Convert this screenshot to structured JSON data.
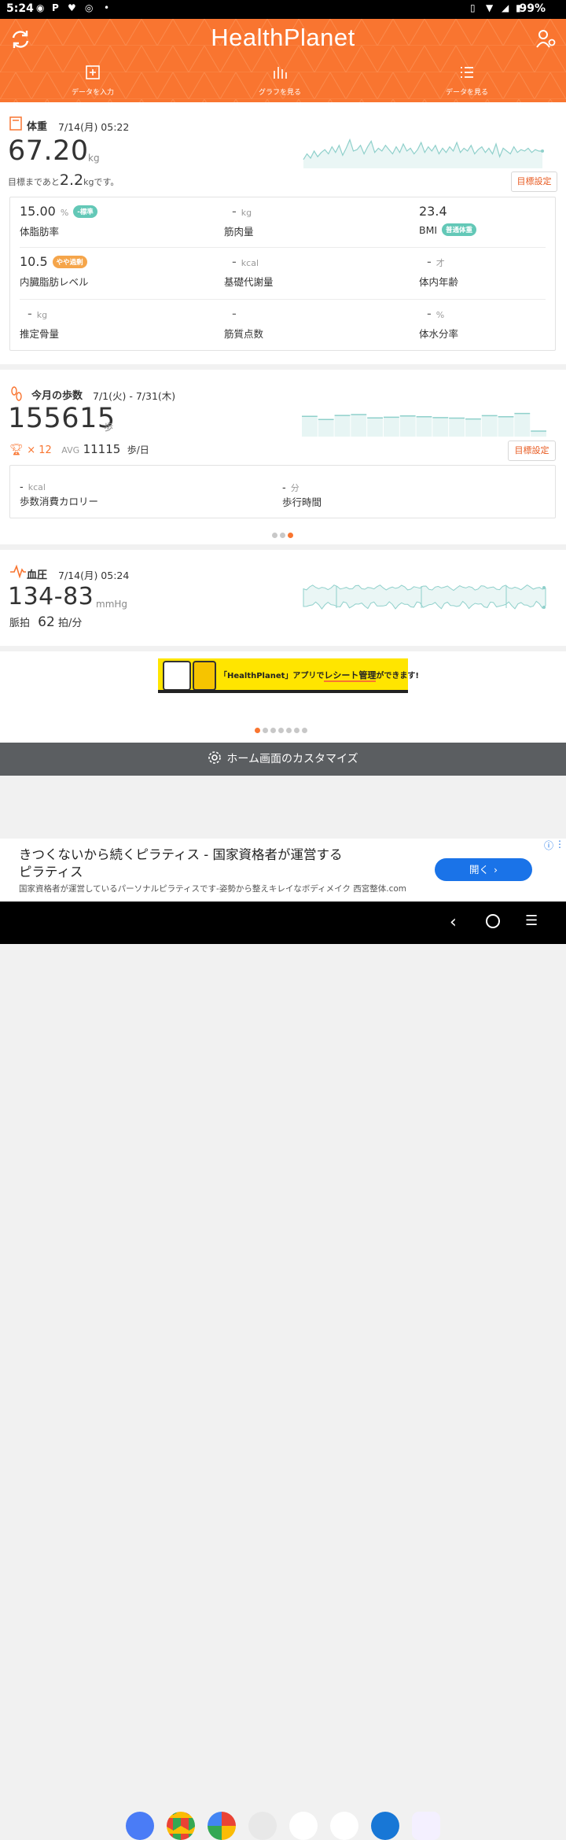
{
  "status": {
    "time": "5:24",
    "battery": "99%"
  },
  "header": {
    "logo": "HealthPlanet",
    "nav": [
      {
        "label": "データを入力",
        "icon": "plus-square-icon"
      },
      {
        "label": "グラフを見る",
        "icon": "bar-chart-icon"
      },
      {
        "label": "データを見る",
        "icon": "list-icon"
      }
    ]
  },
  "weight": {
    "label": "体重",
    "date": "7/14(月) 05:22",
    "value": "67.20",
    "unit": "kg",
    "goal_prefix": "目標まであと",
    "goal_value": "2.2",
    "goal_unit": "kg",
    "goal_suffix": "です。",
    "goal_button": "目標設定",
    "metrics": [
      {
        "value": "15.00",
        "unit": "%",
        "label": "体脂肪率",
        "badge": "-標準",
        "badge_color": "#63c8b7"
      },
      {
        "value": "-",
        "unit": "kg",
        "label": "筋肉量"
      },
      {
        "value": "23.4",
        "unit": "",
        "label": "BMI",
        "badge": "普通体重",
        "badge_color": "#63c8b7"
      },
      {
        "value": "10.5",
        "unit": "",
        "label": "内臓脂肪レベル",
        "badge": "やや過剰",
        "badge_color": "#f5a54a"
      },
      {
        "value": "-",
        "unit": "kcal",
        "label": "基礎代謝量"
      },
      {
        "value": "-",
        "unit": "才",
        "label": "体内年齢"
      },
      {
        "value": "-",
        "unit": "kg",
        "label": "推定骨量"
      },
      {
        "value": "-",
        "unit": "",
        "label": "筋質点数"
      },
      {
        "value": "-",
        "unit": "%",
        "label": "体水分率"
      }
    ],
    "sparkline": [
      0.8,
      0.6,
      0.75,
      0.5,
      0.7,
      0.55,
      0.45,
      0.6,
      0.35,
      0.55,
      0.3,
      0.65,
      0.4,
      0.1,
      0.5,
      0.45,
      0.3,
      0.6,
      0.35,
      0.15,
      0.55,
      0.4,
      0.5,
      0.3,
      0.45,
      0.6,
      0.35,
      0.55,
      0.25,
      0.5,
      0.4,
      0.6,
      0.45,
      0.2,
      0.55,
      0.35,
      0.5,
      0.3,
      0.6,
      0.4,
      0.55,
      0.35,
      0.5,
      0.2,
      0.55,
      0.4,
      0.5,
      0.3,
      0.6,
      0.45,
      0.35,
      0.55,
      0.4,
      0.6,
      0.25,
      0.7,
      0.4,
      0.5,
      0.6,
      0.35,
      0.55,
      0.45,
      0.5,
      0.4,
      0.55,
      0.45,
      0.5,
      0.5
    ]
  },
  "steps": {
    "label": "今月の歩数",
    "date": "7/1(火) - 7/31(木)",
    "value": "155615",
    "unit": "歩",
    "trophy_count": "× 12",
    "avg_label": "AVG",
    "avg_value": "11115",
    "avg_unit": "歩/日",
    "goal_button": "目標設定",
    "metrics": [
      {
        "value": "-",
        "unit": "kcal",
        "label": "歩数消費カロリー"
      },
      {
        "value": "-",
        "unit": "分",
        "label": "歩行時間"
      }
    ],
    "bars": [
      0.92,
      0.78,
      0.96,
      1.0,
      0.85,
      0.88,
      0.94,
      0.9,
      0.86,
      0.84,
      0.8,
      0.95,
      0.9,
      1.05,
      0.25
    ]
  },
  "bp": {
    "label": "血圧",
    "date": "7/14(月) 05:24",
    "value": "134-83",
    "unit": "mmHg",
    "pulse_label": "脈拍",
    "pulse_value": "62",
    "pulse_unit": "拍/分"
  },
  "banner": {
    "text_prefix": "「HealthPlanet」アプリで",
    "text_highlight": "レシート管理",
    "text_suffix": "ができます!"
  },
  "customize": {
    "label": "ホーム画面のカスタマイズ"
  },
  "ad": {
    "title": "きつくないから続くピラティス - 国家資格者が運営する\nピラティス",
    "desc": "国家資格者が運営しているパーソナルピラティスです-姿勢から整えキレイなボディメイク 西宮整体.com",
    "button": "開く"
  }
}
